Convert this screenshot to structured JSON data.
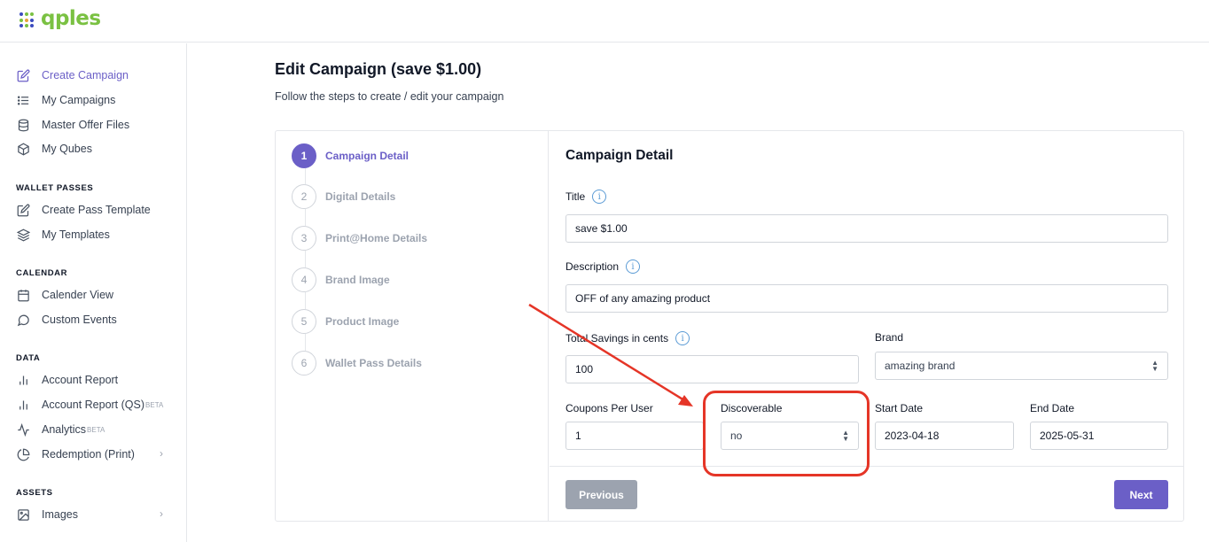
{
  "brand": {
    "name": "qples",
    "dot_colors": [
      "#3b4bbf",
      "#7ac142",
      "#7ac142",
      "#7ac142",
      "#e8a23a",
      "#3b4bbf",
      "#3b4bbf",
      "#7ac142",
      "#3b4bbf"
    ]
  },
  "sidebar": {
    "items": [
      {
        "label": "Create Campaign",
        "icon": "edit-icon",
        "active": true
      },
      {
        "label": "My Campaigns",
        "icon": "list-icon"
      },
      {
        "label": "Master Offer Files",
        "icon": "database-icon"
      },
      {
        "label": "My Qubes",
        "icon": "cube-icon"
      }
    ],
    "sections": [
      {
        "title": "WALLET PASSES",
        "items": [
          {
            "label": "Create Pass Template",
            "icon": "edit-icon"
          },
          {
            "label": "My Templates",
            "icon": "layers-icon"
          }
        ]
      },
      {
        "title": "CALENDAR",
        "items": [
          {
            "label": "Calender View",
            "icon": "calendar-icon"
          },
          {
            "label": "Custom Events",
            "icon": "chat-icon"
          }
        ]
      },
      {
        "title": "DATA",
        "items": [
          {
            "label": "Account Report",
            "icon": "bar-chart-icon"
          },
          {
            "label": "Account Report (QS)",
            "icon": "bar-chart-icon",
            "badge": "BETA"
          },
          {
            "label": "Analytics",
            "icon": "activity-icon",
            "badge": "BETA"
          },
          {
            "label": "Redemption (Print)",
            "icon": "pie-chart-icon",
            "chevron": "›"
          }
        ]
      },
      {
        "title": "ASSETS",
        "items": [
          {
            "label": "Images",
            "icon": "image-icon",
            "chevron": "›"
          }
        ]
      }
    ]
  },
  "page": {
    "title": "Edit Campaign (save $1.00)",
    "subtitle": "Follow the steps to create / edit your campaign"
  },
  "steps": [
    {
      "num": "1",
      "label": "Campaign Detail",
      "active": true
    },
    {
      "num": "2",
      "label": "Digital Details"
    },
    {
      "num": "3",
      "label": "Print@Home Details"
    },
    {
      "num": "4",
      "label": "Brand Image"
    },
    {
      "num": "5",
      "label": "Product Image"
    },
    {
      "num": "6",
      "label": "Wallet Pass Details"
    }
  ],
  "form": {
    "title": "Campaign Detail",
    "title_label": "Title",
    "title_value": "save $1.00",
    "description_label": "Description",
    "description_value": "OFF of any amazing product",
    "savings_label": "Total Savings in cents",
    "savings_value": "100",
    "brand_label": "Brand",
    "brand_value": "amazing brand",
    "coupons_label": "Coupons Per User",
    "coupons_value": "1",
    "discoverable_label": "Discoverable",
    "discoverable_value": "no",
    "start_label": "Start Date",
    "start_value": "2023-04-18",
    "end_label": "End Date",
    "end_value": "2025-05-31",
    "info_glyph": "i",
    "select_arrow_up": "▲",
    "select_arrow_down": "▼"
  },
  "buttons": {
    "previous": "Previous",
    "next": "Next"
  },
  "colors": {
    "accent": "#6b5fc7",
    "brand_green": "#7ac142",
    "annotation": "#e53527"
  }
}
